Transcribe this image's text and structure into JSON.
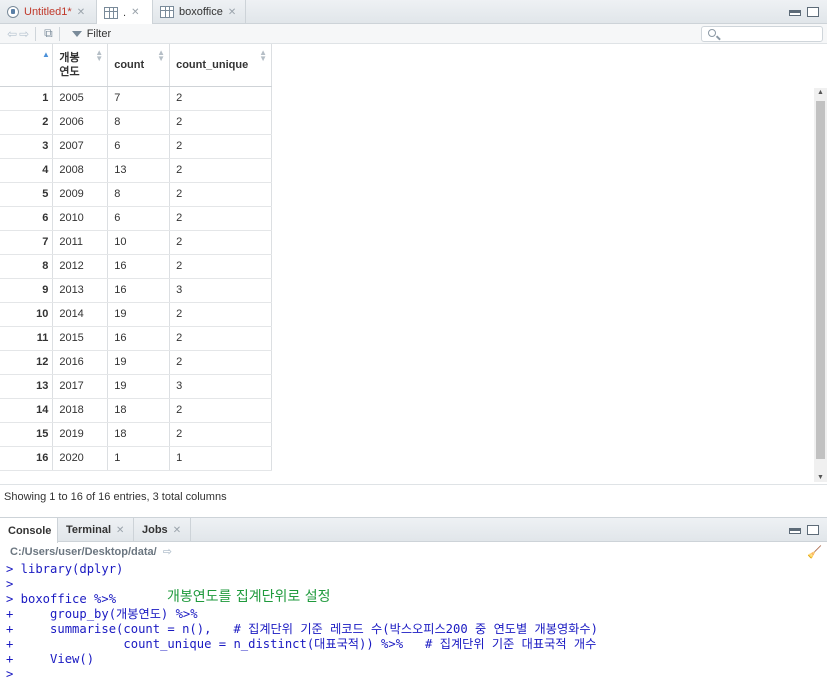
{
  "source_tabs": [
    {
      "label": "Untitled1*",
      "kind": "script"
    },
    {
      "label": ".",
      "kind": "data"
    },
    {
      "label": "boxoffice",
      "kind": "data"
    }
  ],
  "toolbar": {
    "filter_label": "Filter",
    "search_placeholder": ""
  },
  "table": {
    "columns": [
      "개봉\n연도",
      "count",
      "count_unique"
    ],
    "rows": [
      [
        "1",
        "2005",
        "7",
        "2"
      ],
      [
        "2",
        "2006",
        "8",
        "2"
      ],
      [
        "3",
        "2007",
        "6",
        "2"
      ],
      [
        "4",
        "2008",
        "13",
        "2"
      ],
      [
        "5",
        "2009",
        "8",
        "2"
      ],
      [
        "6",
        "2010",
        "6",
        "2"
      ],
      [
        "7",
        "2011",
        "10",
        "2"
      ],
      [
        "8",
        "2012",
        "16",
        "2"
      ],
      [
        "9",
        "2013",
        "16",
        "3"
      ],
      [
        "10",
        "2014",
        "19",
        "2"
      ],
      [
        "11",
        "2015",
        "16",
        "2"
      ],
      [
        "12",
        "2016",
        "19",
        "2"
      ],
      [
        "13",
        "2017",
        "19",
        "3"
      ],
      [
        "14",
        "2018",
        "18",
        "2"
      ],
      [
        "15",
        "2019",
        "18",
        "2"
      ],
      [
        "16",
        "2020",
        "1",
        "1"
      ]
    ]
  },
  "status": "Showing 1 to 16 of 16 entries, 3 total columns",
  "console_tabs": [
    "Console",
    "Terminal",
    "Jobs"
  ],
  "console_path": "C:/Users/user/Desktop/data/",
  "console_lines": [
    "> library(dplyr)",
    ">",
    "> boxoffice %>%",
    "+     group_by(개봉연도) %>%",
    "+     summarise(count = n(),   # 집계단위 기준 레코드 수(박스오피스200 중 연도별 개봉영화수)",
    "+               count_unique = n_distinct(대표국적)) %>%   # 집계단위 기준 대표국적 개수",
    "+     View()",
    ">"
  ],
  "annotation": "개봉연도를 집계단위로 설정",
  "colors": {
    "annotation": "#1f9a3c",
    "console_text": "#1a1ac2",
    "unsaved_tab": "#c0392b"
  }
}
